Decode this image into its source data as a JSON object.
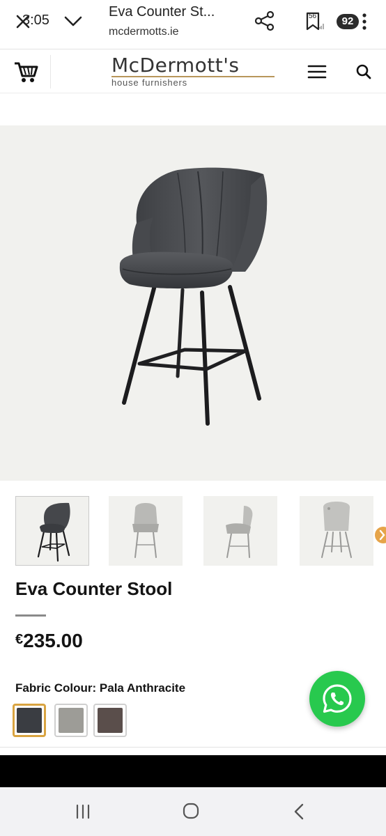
{
  "browser": {
    "time": "3:05",
    "title": "Eva Counter St...",
    "url": "mcdermotts.ie",
    "tab_count": "92",
    "sim_label": "56",
    "icons": [
      "close-icon",
      "chevron-down-icon",
      "share-icon",
      "bookmark-icon",
      "menu-dots-icon"
    ]
  },
  "header": {
    "logo_name": "McDermott's",
    "logo_tagline": "house furnishers",
    "icons": [
      "cart-icon",
      "hamburger-icon",
      "search-icon"
    ],
    "logo_rule_color": "#b8965a"
  },
  "product": {
    "name": "Eva Counter Stool",
    "currency": "€",
    "price": "235.00",
    "fabric_label": "Fabric Colour:",
    "fabric_value": "Pala Anthracite",
    "swatches": [
      {
        "name": "Pala Anthracite",
        "color": "#3a3d42",
        "selected": true
      },
      {
        "name": "light grey",
        "color": "#9d9c97",
        "selected": false
      },
      {
        "name": "brown",
        "color": "#5a4e4b",
        "selected": false
      }
    ],
    "thumbnail_count": 4,
    "selected_thumbnail": 1
  },
  "colors": {
    "accent_selected": "#d9a441",
    "whatsapp": "#28c94e",
    "hero_background": "#f1f1ee"
  },
  "nav": {
    "icons": [
      "recents-icon",
      "home-icon",
      "back-icon"
    ]
  }
}
